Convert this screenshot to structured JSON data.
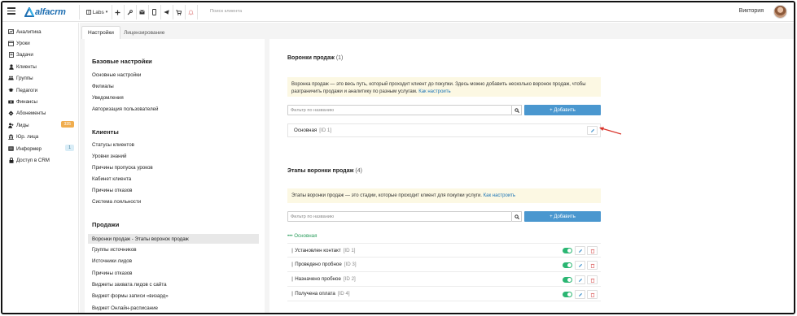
{
  "topbar": {
    "logo_text": "alfacrm",
    "branch_label": "Labs",
    "search_placeholder": "Поиск клиента",
    "user_name": "Виктория",
    "icons": [
      "plus-icon",
      "wrench-icon",
      "envelope-icon",
      "phone-icon",
      "telegram-icon",
      "cart-icon",
      "bell-icon"
    ]
  },
  "sidebar": {
    "items": [
      {
        "label": "Аналитика",
        "icon": "chart-icon"
      },
      {
        "label": "Уроки",
        "icon": "calendar-icon"
      },
      {
        "label": "Задачи",
        "icon": "tasks-icon"
      },
      {
        "label": "Клиенты",
        "icon": "user-icon"
      },
      {
        "label": "Группы",
        "icon": "group-icon"
      },
      {
        "label": "Педагоги",
        "icon": "teacher-icon"
      },
      {
        "label": "Финансы",
        "icon": "money-icon"
      },
      {
        "label": "Абонементы",
        "icon": "ticket-icon"
      },
      {
        "label": "Лиды",
        "icon": "lead-icon",
        "badge": "335"
      },
      {
        "label": "Юр. лица",
        "icon": "building-icon"
      },
      {
        "label": "Информер",
        "icon": "informer-icon",
        "badge": "1"
      },
      {
        "label": "Доступ в CRM",
        "icon": "lock-icon"
      }
    ]
  },
  "tabs": [
    {
      "label": "Настройки",
      "active": true
    },
    {
      "label": "Лицензирование",
      "active": false
    }
  ],
  "settings": {
    "basic": {
      "title": "Базовые настройки",
      "links": [
        "Основные настройки",
        "Филиалы",
        "Уведомления",
        "Авторизация пользователей"
      ]
    },
    "clients": {
      "title": "Клиенты",
      "links": [
        "Статусы клиентов",
        "Уровни знаний",
        "Причины пропуска уроков",
        "Кабинет клиента",
        "Причины отказов",
        "Система лояльности"
      ]
    },
    "sales": {
      "title": "Продажи",
      "links": [
        "Воронки продаж - Этапы воронок продаж",
        "Группы источников",
        "Источники лидов",
        "Причины отказов",
        "Виджеты захвата лидов с сайта",
        "Виджет формы записи «визард»",
        "Виджет Онлайн-расписание"
      ],
      "selected_index": 0
    }
  },
  "funnels": {
    "title": "Воронки продаж",
    "count": "(1)",
    "info_text": "Воронка продаж — это весь путь, который проходит клиент до покупки. Здесь можно добавить несколько воронок продаж, чтобы разграничить продажи и аналитику по разным услугам.",
    "info_link": "Как настроить",
    "filter_placeholder": "Фильтр по названию",
    "add_label": "+ Добавить",
    "items": [
      {
        "name": "Основная",
        "id": "[ID 1]"
      }
    ]
  },
  "stages": {
    "title": "Этапы воронки продаж",
    "count": "(4)",
    "info_text": "Этапы воронки продаж — это стадии, которые проходит клиент для покупки услуги.",
    "info_link": "Как настроить",
    "filter_placeholder": "Фильтр по названию",
    "add_label": "+ Добавить",
    "group_label": "••• Основная",
    "items": [
      {
        "name": "Установлен контакт",
        "id": "[ID 1]"
      },
      {
        "name": "Проведено пробное",
        "id": "[ID 3]"
      },
      {
        "name": "Назначено пробное",
        "id": "[ID 2]"
      },
      {
        "name": "Получена оплата",
        "id": "[ID 4]"
      }
    ]
  },
  "colors": {
    "accent": "#4a97cf",
    "toggle_on": "#2bb673",
    "info_bg": "#fcf8e3",
    "badge_orange": "#f0ad4e",
    "arrow": "#d9342b"
  }
}
